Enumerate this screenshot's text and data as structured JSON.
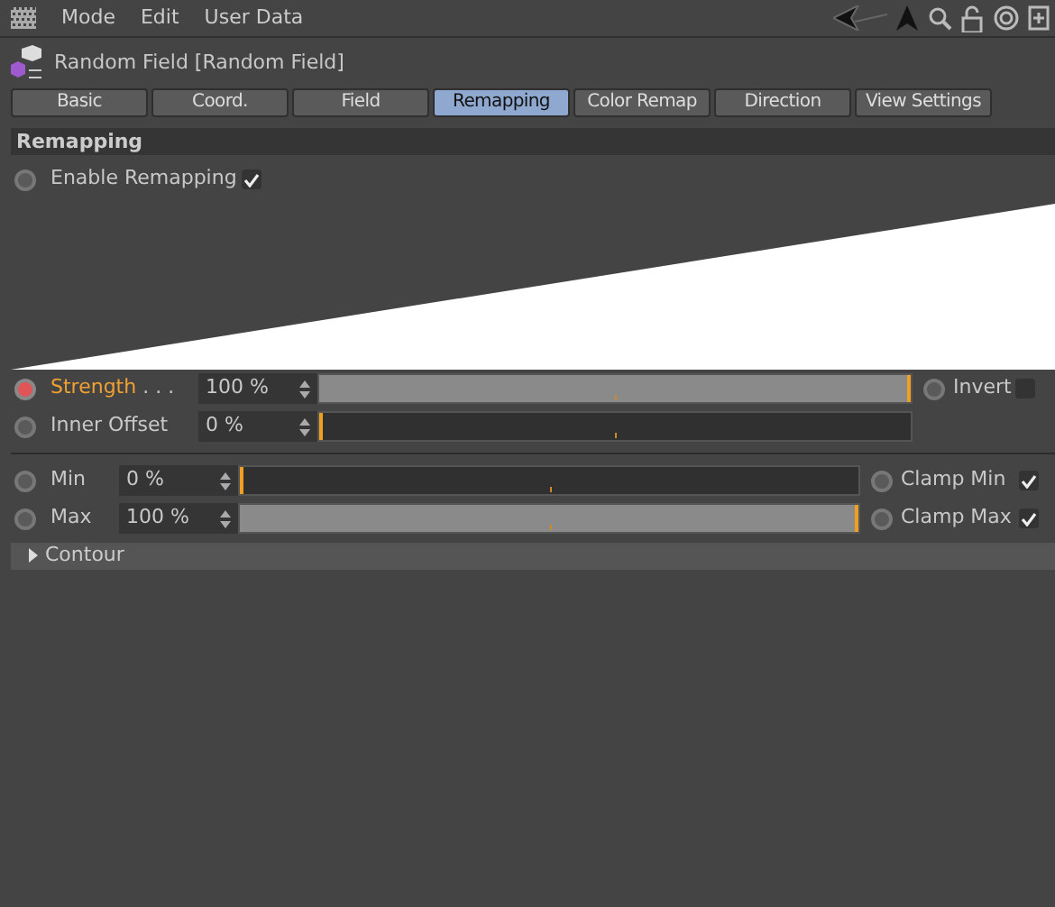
{
  "menu": [
    "Mode",
    "Edit",
    "User Data"
  ],
  "object_title": "Random Field [Random Field]",
  "tabs": [
    {
      "label": "Basic",
      "selected": false
    },
    {
      "label": "Coord.",
      "selected": false
    },
    {
      "label": "Field",
      "selected": false
    },
    {
      "label": "Remapping",
      "selected": true
    },
    {
      "label": "Color Remap",
      "selected": false
    },
    {
      "label": "Direction",
      "selected": false
    },
    {
      "label": "View Settings",
      "selected": false
    }
  ],
  "section_title": "Remapping",
  "enable": {
    "label": "Enable Remapping",
    "animated": false,
    "checked": true
  },
  "groups": [
    [
      {
        "label": "Strength",
        "dots": ". . .",
        "animated": true,
        "value": "100 %",
        "level": 1,
        "option": {
          "label": "Invert",
          "animated": false,
          "checked": false
        }
      },
      {
        "label": "Inner Offset",
        "animated": false,
        "value": "0 %",
        "level": 0
      }
    ],
    [
      {
        "label": "Min",
        "animated": false,
        "value": "0 %",
        "level": 0,
        "option": {
          "label": "Clamp Min",
          "animated": false,
          "checked": true
        }
      },
      {
        "label": "Max",
        "animated": false,
        "value": "100 %",
        "level": 1,
        "option": {
          "label": "Clamp Max",
          "animated": false,
          "checked": true
        }
      }
    ]
  ],
  "contour": {
    "label": "Contour",
    "expanded": false
  }
}
